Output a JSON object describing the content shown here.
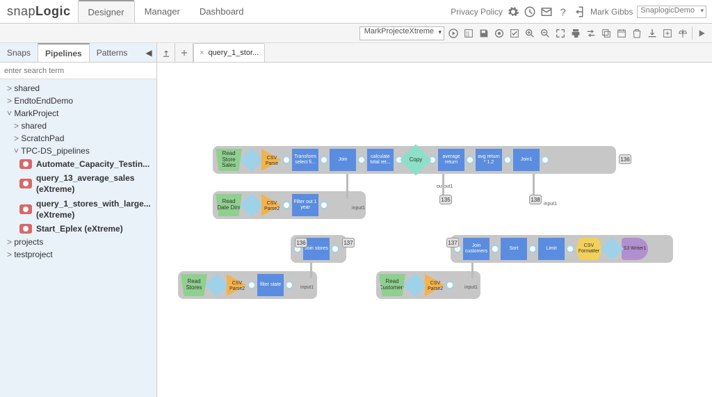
{
  "brand": {
    "part1": "snap",
    "part2": "Logic"
  },
  "nav": {
    "designer": "Designer",
    "manager": "Manager",
    "dashboard": "Dashboard"
  },
  "header": {
    "privacy": "Privacy Policy",
    "user": "Mark Gibbs",
    "org": "SnaplogicDemo"
  },
  "toolbar": {
    "project": "MarkProjecteXtreme"
  },
  "side_tabs": {
    "snaps": "Snaps",
    "pipelines": "Pipelines",
    "patterns": "Patterns"
  },
  "search_placeholder": "enter search term",
  "tree": {
    "n0": "shared",
    "n1": "EndtoEndDemo",
    "n2": "MarkProject",
    "n2a": "shared",
    "n2b": "ScratchPad",
    "n2c": "TPC-DS_pipelines",
    "p1": "Automate_Capacity_Testin...",
    "p2": "query_13_average_sales (eXtreme)",
    "p3": "query_1_stores_with_large... (eXtreme)",
    "p4": "Start_Eplex (eXtreme)",
    "n3": "projects",
    "n4": "testproject"
  },
  "canvas_tab": "query_1_stor...",
  "snaps": {
    "read_store_sales": "Read Store Sales",
    "csv_parse": "CSV Parse",
    "transform": "Transform select fi...",
    "join": "Join",
    "calc": "calculate total ret...",
    "copy": "Copy",
    "avg_return": "average return",
    "avg_12": "avg return * 1.2",
    "join1": "Join1",
    "read_date": "Read Date Dim",
    "csv_parse2": "CSV Parse2",
    "filter_year": "Filter out 1 year",
    "join_stores": "Join stores",
    "read_stores": "Read Stores",
    "filter_state": "filter state",
    "join_cust": "Join customers",
    "sort": "Sort",
    "limit": "Limit",
    "csv_fmt": "CSV Formatter",
    "s3": "S3 Writer1",
    "read_cust": "Read Customers",
    "input1": "input1",
    "output1": "output1",
    "b135": "135",
    "b136": "136",
    "b137": "137",
    "b138": "138"
  }
}
